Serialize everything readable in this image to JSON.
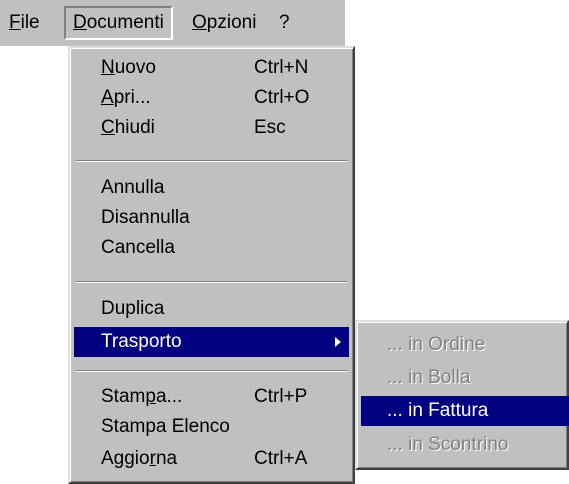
{
  "menubar": {
    "items": [
      {
        "label": "File",
        "mnemonic": "F"
      },
      {
        "label": "Documenti",
        "mnemonic": "D",
        "active": true
      },
      {
        "label": "Opzioni",
        "mnemonic": "O"
      },
      {
        "label": "?"
      }
    ]
  },
  "documenti_menu": {
    "items": [
      {
        "label": "Nuovo",
        "shortcut": "Ctrl+N"
      },
      {
        "label": "Apri...",
        "shortcut": "Ctrl+O"
      },
      {
        "label": "Chiudi",
        "shortcut": "Esc"
      },
      {
        "label": "Annulla"
      },
      {
        "label": "Disannulla"
      },
      {
        "label": "Cancella"
      },
      {
        "label": "Duplica"
      },
      {
        "label": "Trasporto",
        "has_submenu": true,
        "highlighted": true
      },
      {
        "label": "Stampa...",
        "shortcut": "Ctrl+P"
      },
      {
        "label": "Stampa Elenco"
      },
      {
        "label": "Aggiorna",
        "shortcut": "Ctrl+A"
      }
    ]
  },
  "trasporto_submenu": {
    "items": [
      {
        "label": "... in Ordine",
        "enabled": false
      },
      {
        "label": "... in Bolla",
        "enabled": false
      },
      {
        "label": "... in Fattura",
        "enabled": true,
        "highlighted": true
      },
      {
        "label": "... in Scontrino",
        "enabled": false
      }
    ]
  },
  "colors": {
    "menu_face": "#c0c0c0",
    "highlight": "#000080",
    "disabled_text": "#808080"
  }
}
